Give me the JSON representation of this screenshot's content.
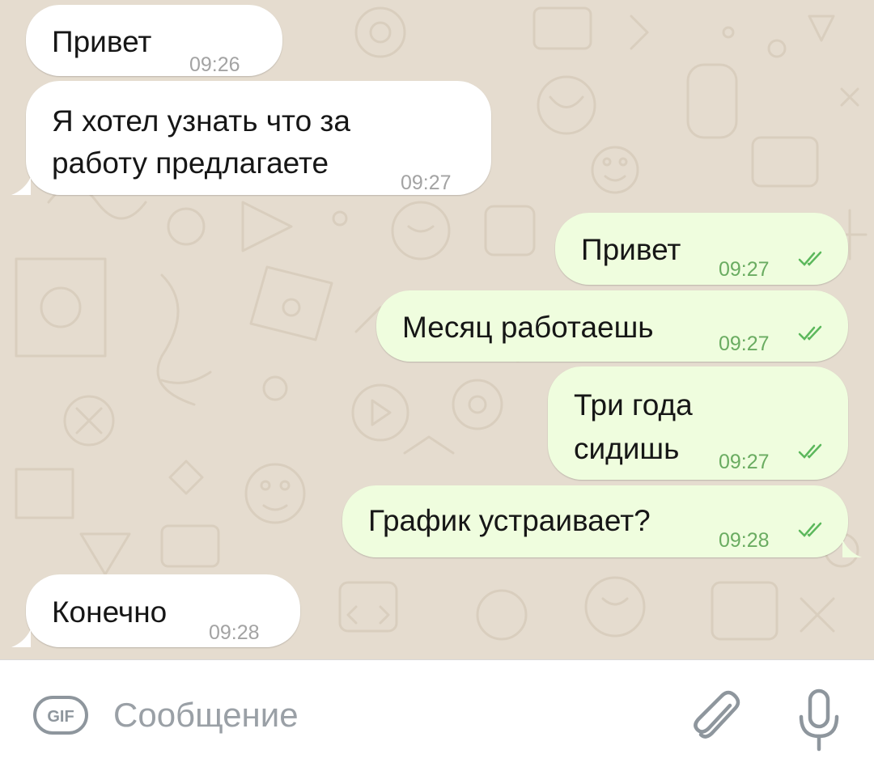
{
  "messages": [
    {
      "direction": "incoming",
      "text_lines": [
        "Привет"
      ],
      "time": "09:26"
    },
    {
      "direction": "incoming",
      "text_lines": [
        "Я хотел узнать что за",
        "работу предлагаете"
      ],
      "time": "09:27"
    },
    {
      "direction": "outgoing",
      "text_lines": [
        "Привет"
      ],
      "time": "09:27",
      "status": "read-double-check"
    },
    {
      "direction": "outgoing",
      "text_lines": [
        "Месяц работаешь"
      ],
      "time": "09:27",
      "status": "read-double-check"
    },
    {
      "direction": "outgoing",
      "text_lines": [
        "Три года",
        "сидишь"
      ],
      "time": "09:27",
      "status": "read-double-check"
    },
    {
      "direction": "outgoing",
      "text_lines": [
        "График устраивает?"
      ],
      "time": "09:28",
      "status": "read-double-check"
    },
    {
      "direction": "incoming",
      "text_lines": [
        "Конечно"
      ],
      "time": "09:28"
    }
  ],
  "composer": {
    "placeholder": "Сообщение",
    "gif_label": "GIF",
    "icons": [
      "gif-icon",
      "attach-paperclip-icon",
      "microphone-icon"
    ]
  },
  "colors": {
    "chat_background": "#e5dccf",
    "incoming_bubble": "#ffffff",
    "outgoing_bubble": "#effdde",
    "incoming_time": "#a3a3a3",
    "outgoing_time": "#6aac61",
    "read_check": "#5cb85c",
    "composer_icon": "#8e969d"
  }
}
